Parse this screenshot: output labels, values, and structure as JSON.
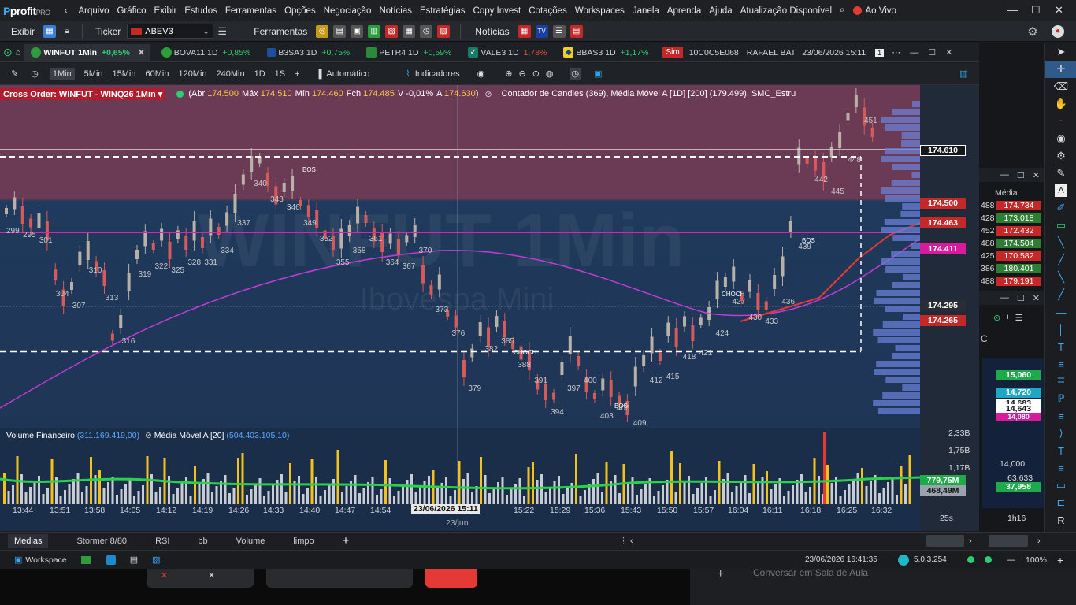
{
  "menu": {
    "logo": "profit",
    "logo_suffix": "PRO",
    "items": [
      "Arquivo",
      "Gráfico",
      "Exibir",
      "Estudos",
      "Ferramentas",
      "Opções",
      "Negociação",
      "Notícias",
      "Estratégias",
      "Copy Invest",
      "Cotações",
      "Workspaces",
      "Janela",
      "Aprenda",
      "Ajuda",
      "Atualização Disponível"
    ],
    "live": "Ao Vivo",
    "win_min": "—",
    "win_max": "☐",
    "win_close": "✕"
  },
  "toolbar": {
    "exibir": "Exibir",
    "ticker_label": "Ticker",
    "ticker_value": "ABEV3",
    "ferramentas": "Ferramentas",
    "noticias": "Notícias"
  },
  "tabs": [
    {
      "label": "WINFUT 1Min",
      "change": "+0,65%",
      "dir": "pos",
      "active": true,
      "color": "#2e9c3b"
    },
    {
      "label": "BOVA11 1D",
      "change": "+0,85%",
      "dir": "pos",
      "color": "#2e9c3b"
    },
    {
      "label": "B3SA3 1D",
      "change": "+0,75%",
      "dir": "pos",
      "color": "#1c4fa0"
    },
    {
      "label": "PETR4 1D",
      "change": "+0,59%",
      "dir": "pos",
      "color": "#2a8a3a"
    },
    {
      "label": "VALE3 1D",
      "change": "1,78%",
      "dir": "neg",
      "color": "#1a7a6a"
    },
    {
      "label": "BBAS3 1D",
      "change": "+1,17%",
      "dir": "pos",
      "color": "#f2d21a"
    }
  ],
  "tabs_right": {
    "sim": "Sim",
    "account": "10C0C5E068",
    "user": "RAFAEL BAT",
    "datetime": "23/06/2026 15:11",
    "page": "1"
  },
  "chart_tools": {
    "timeframes": [
      "1Min",
      "5Min",
      "15Min",
      "60Min",
      "120Min",
      "240Min",
      "1D",
      "1S"
    ],
    "selected": "1Min",
    "auto": "Automático",
    "indicators": "Indicadores"
  },
  "infobar": {
    "cross_order": "Cross Order: WINFUT - WINQ26 1Min",
    "abr_label": "Abr",
    "abr": "174.500",
    "max_label": "Máx",
    "max": "174.510",
    "min_label": "Mín",
    "min": "174.460",
    "fch_label": "Fch",
    "fch": "174.485",
    "var": "V -0,01%",
    "a_label": "A",
    "a": "174.630",
    "studies": "Contador de Candles (369), Média Móvel A [1D] [200] (179.499), SMC_Estru"
  },
  "watermark": {
    "big": "WINFUT 1Min",
    "sub": "Ibovespa Mini"
  },
  "price_tags": [
    {
      "value": "174.610",
      "color": "#1a1c20",
      "border": "#ffffff"
    },
    {
      "value": "174.500",
      "color": "#c62828"
    },
    {
      "value": "174.463",
      "color": "#c62828"
    },
    {
      "value": "174.411",
      "color": "#d81b9a"
    },
    {
      "value": "174.295",
      "color": "#2a2d33"
    },
    {
      "value": "174.265",
      "color": "#c62828"
    }
  ],
  "labels": {
    "bos": "BOS",
    "choch": "CHOCH",
    "counts": [
      "299",
      "295",
      "301",
      "304",
      "307",
      "310",
      "313",
      "316",
      "319",
      "322",
      "325",
      "328",
      "331",
      "334",
      "337",
      "340",
      "343",
      "346",
      "349",
      "352",
      "355",
      "358",
      "361",
      "364",
      "367",
      "370",
      "373",
      "376",
      "379",
      "382",
      "385",
      "388",
      "391",
      "394",
      "397",
      "400",
      "403",
      "406",
      "409",
      "412",
      "415",
      "418",
      "421",
      "424",
      "427",
      "430",
      "433",
      "436",
      "439",
      "442",
      "445",
      "448",
      "451"
    ]
  },
  "volume": {
    "title": "Volume Financeiro",
    "value": "(311.169.419,00)",
    "ma_title": "Média Móvel A [20]",
    "ma_value": "(504.403.105,10)",
    "axis": [
      "2,33B",
      "1,75B",
      "1,17B"
    ],
    "tags": [
      {
        "value": "779,75M",
        "color": "#1faa4a"
      },
      {
        "value": "468,49M",
        "color": "#9aa3ad"
      }
    ]
  },
  "time_axis": [
    "13:44",
    "13:51",
    "13:58",
    "14:05",
    "14:12",
    "14:19",
    "14:26",
    "14:33",
    "14:40",
    "14:47",
    "14:54",
    "15:22",
    "15:29",
    "15:36",
    "15:43",
    "15:50",
    "15:57",
    "16:04",
    "16:11",
    "16:18",
    "16:25",
    "16:32"
  ],
  "crosshair_time": "23/06/2026 15:11",
  "date_label": "23/jun",
  "zoom": "25s",
  "subtabs": [
    "Medias",
    "Stormer 8/80",
    "RSI",
    "bb",
    "Volume",
    "limpo"
  ],
  "right_panel": {
    "header": "Média",
    "book": [
      {
        "q": "488",
        "p": "174.734"
      },
      {
        "q": "428",
        "p": "173.018"
      },
      {
        "q": "452",
        "p": "172.432"
      },
      {
        "q": "488",
        "p": "174.504"
      },
      {
        "q": "425",
        "p": "170.582"
      },
      {
        "q": "386",
        "p": "180.401"
      },
      {
        "q": "488",
        "p": "179.191"
      }
    ],
    "mini_prices": [
      {
        "value": "15,060",
        "color": "#1faa4a"
      },
      {
        "value": "14,720",
        "color": "#1fa6c2"
      },
      {
        "value": "14,683",
        "color": "#ffffff"
      },
      {
        "value": "14,643",
        "color": "#ffffff"
      },
      {
        "value": "14,080",
        "color": "#d81b9a"
      }
    ],
    "mini_axis": "14,000",
    "mini_val1": "63,633",
    "mini_val2": "37,958",
    "mini_time": "1h16",
    "letter": "C"
  },
  "status": {
    "workspace": "Workspace",
    "datetime": "23/06/2026 16:41:35",
    "version": "5.0.3.254",
    "zoom": "100%"
  },
  "taskbar": {
    "chat": "Conversar em Sala de Aula"
  }
}
